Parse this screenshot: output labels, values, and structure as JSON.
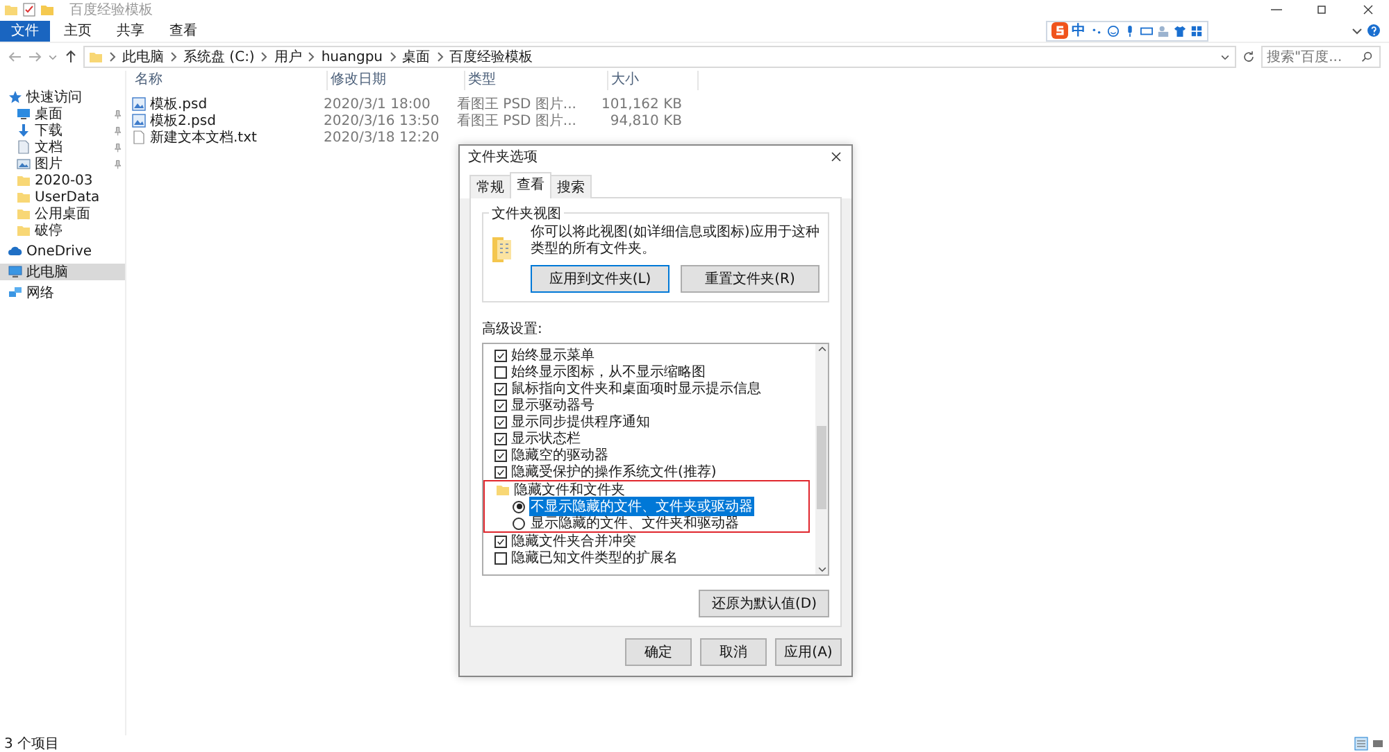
{
  "window": {
    "title": "百度经验模板"
  },
  "ribbon_tabs": [
    {
      "label": "文件",
      "selected": true
    },
    {
      "label": "主页",
      "selected": false
    },
    {
      "label": "共享",
      "selected": false
    },
    {
      "label": "查看",
      "selected": false
    }
  ],
  "ime_toolbar": {
    "mode": "中"
  },
  "address": {
    "segments": [
      "此电脑",
      "系统盘 (C:)",
      "用户",
      "huangpu",
      "桌面",
      "百度经验模板"
    ],
    "search_placeholder": "搜索\"百度..."
  },
  "sidebar": [
    {
      "label": "快速访问",
      "kind": "star",
      "selected": false,
      "children": [
        {
          "label": "桌面",
          "kind": "desktop",
          "pinned": true,
          "selected": false
        },
        {
          "label": "下载",
          "kind": "download",
          "pinned": true,
          "selected": false
        },
        {
          "label": "文档",
          "kind": "document",
          "pinned": true,
          "selected": false
        },
        {
          "label": "图片",
          "kind": "pictures",
          "pinned": true,
          "selected": false
        },
        {
          "label": "2020-03",
          "kind": "folder",
          "pinned": false,
          "selected": false
        },
        {
          "label": "UserData",
          "kind": "folder",
          "pinned": false,
          "selected": false
        },
        {
          "label": "公用桌面",
          "kind": "folder",
          "pinned": false,
          "selected": false
        },
        {
          "label": "破停",
          "kind": "folder",
          "pinned": false,
          "selected": false
        }
      ]
    },
    {
      "label": "OneDrive",
      "kind": "cloud",
      "selected": false
    },
    {
      "label": "此电脑",
      "kind": "pc",
      "selected": true
    },
    {
      "label": "网络",
      "kind": "network",
      "selected": false
    }
  ],
  "table": {
    "columns": [
      "名称",
      "修改日期",
      "类型",
      "大小"
    ],
    "rows": [
      {
        "kind": "psd",
        "name": "模板.psd",
        "date": "2020/3/1 18:00",
        "type": "看图王 PSD 图片...",
        "size": "101,162 KB"
      },
      {
        "kind": "psd",
        "name": "模板2.psd",
        "date": "2020/3/16 13:50",
        "type": "看图王 PSD 图片...",
        "size": "94,810 KB"
      },
      {
        "kind": "txt",
        "name": "新建文本文档.txt",
        "date": "2020/3/18 12:20"
      }
    ]
  },
  "status_bar": {
    "item_count": "3 个项目"
  },
  "dialog": {
    "title": "文件夹选项",
    "tabs": [
      {
        "label": "常规",
        "selected": false
      },
      {
        "label": "查看",
        "selected": true
      },
      {
        "label": "搜索",
        "selected": false
      }
    ],
    "folder_views": {
      "title": "文件夹视图",
      "description": "你可以将此视图(如详细信息或图标)应用于这种类型的所有文件夹。",
      "buttons": [
        "应用到文件夹(L)",
        "重置文件夹(R)"
      ]
    },
    "advanced_label": "高级设置:",
    "advanced": [
      {
        "kind": "checkbox",
        "label": "始终显示菜单",
        "checked": true
      },
      {
        "kind": "checkbox",
        "label": "始终显示图标，从不显示缩略图",
        "checked": false
      },
      {
        "kind": "checkbox",
        "label": "鼠标指向文件夹和桌面项时显示提示信息",
        "checked": true
      },
      {
        "kind": "checkbox",
        "label": "显示驱动器号",
        "checked": true
      },
      {
        "kind": "checkbox",
        "label": "显示同步提供程序通知",
        "checked": true
      },
      {
        "kind": "checkbox",
        "label": "显示状态栏",
        "checked": true
      },
      {
        "kind": "checkbox",
        "label": "隐藏空的驱动器",
        "checked": true
      },
      {
        "kind": "checkbox",
        "label": "隐藏受保护的操作系统文件(推荐)",
        "checked": true
      },
      {
        "kind": "group",
        "label": "隐藏文件和文件夹",
        "annotated": true,
        "children": [
          {
            "kind": "radio",
            "label": "不显示隐藏的文件、文件夹或驱动器",
            "checked": true,
            "selected": true
          },
          {
            "kind": "radio",
            "label": "显示隐藏的文件、文件夹和驱动器",
            "checked": false,
            "selected": false
          }
        ]
      },
      {
        "kind": "checkbox",
        "label": "隐藏文件夹合并冲突",
        "checked": true
      },
      {
        "kind": "checkbox",
        "label": "隐藏已知文件类型的扩展名",
        "checked": false
      }
    ],
    "restore_button": "还原为默认值(D)",
    "footer_buttons": [
      "确定",
      "取消",
      "应用(A)"
    ]
  }
}
